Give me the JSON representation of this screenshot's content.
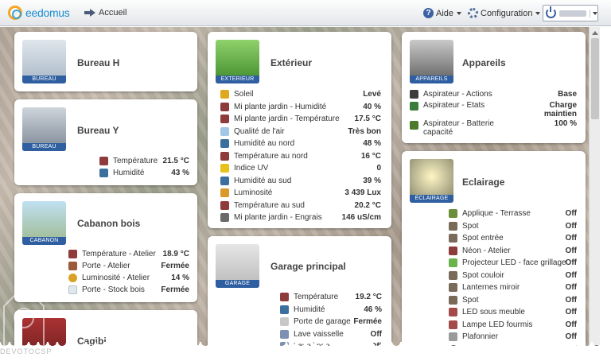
{
  "app": {
    "brand": "eedomus",
    "home_label": "Accueil"
  },
  "menu": {
    "help_label": "Aide",
    "config_label": "Configuration"
  },
  "watermark": {
    "text": "DEVOTOCSP"
  },
  "cards": {
    "bureau_h": {
      "title": "Bureau H",
      "thumb_label": "BUREAU"
    },
    "bureau_y": {
      "title": "Bureau Y",
      "thumb_label": "BUREAU",
      "rows": [
        {
          "label": "Température",
          "value": "21.5 °C"
        },
        {
          "label": "Humidité",
          "value": "43 %"
        }
      ]
    },
    "cabanon": {
      "title": "Cabanon bois",
      "thumb_label": "CABANON",
      "rows": [
        {
          "label": "Température - Atelier",
          "value": "18.9 °C"
        },
        {
          "label": "Porte - Atelier",
          "value": "Fermée"
        },
        {
          "label": "Luminosité - Atelier",
          "value": "14 %"
        },
        {
          "label": "Porte - Stock bois",
          "value": "Fermée"
        }
      ]
    },
    "cagibi": {
      "title": "Cagibi"
    },
    "exterieur": {
      "title": "Extérieur",
      "thumb_label": "EXTERIEUR",
      "rows": [
        {
          "label": "Soleil",
          "value": "Levé"
        },
        {
          "label": "Mi plante jardin - Humidité",
          "value": "40 %"
        },
        {
          "label": "Mi plante jardin - Température",
          "value": "17.5 °C"
        },
        {
          "label": "Qualité de l'air",
          "value": "Très bon"
        },
        {
          "label": "Humidité au nord",
          "value": "48 %"
        },
        {
          "label": "Température au nord",
          "value": "16 °C"
        },
        {
          "label": "Indice UV",
          "value": "0"
        },
        {
          "label": "Humidité au sud",
          "value": "39 %"
        },
        {
          "label": "Luminosité",
          "value": "3 439 Lux"
        },
        {
          "label": "Température au sud",
          "value": "20.2 °C"
        },
        {
          "label": "Mi plante jardin - Engrais",
          "value": "146 uS/cm"
        }
      ]
    },
    "garage": {
      "title": "Garage principal",
      "thumb_label": "GARAGE",
      "rows": [
        {
          "label": "Température",
          "value": "19.2 °C"
        },
        {
          "label": "Humidité",
          "value": "46 %"
        },
        {
          "label": "Porte de garage",
          "value": "Fermée"
        },
        {
          "label": "Lave vaisselle",
          "value": "Off"
        },
        {
          "label": "Lave linge",
          "value": "Off"
        }
      ]
    },
    "appareils": {
      "title": "Appareils",
      "thumb_label": "APPAREILS",
      "rows": [
        {
          "label": "Aspirateur - Actions",
          "value": "Base"
        },
        {
          "label": "Aspirateur - Etats",
          "value_line1": "Charge",
          "value_line2": "maintien"
        },
        {
          "label_line1": "Aspirateur - Batterie",
          "label_line2": "capacité",
          "value": "100 %"
        }
      ]
    },
    "eclairage": {
      "title": "Eclairage",
      "thumb_label": "ÉCLAIRAGE",
      "rows": [
        {
          "label": "Applique - Terrasse",
          "value": "Off"
        },
        {
          "label": "Spot",
          "value": "Off"
        },
        {
          "label": "Spot entrée",
          "value": "Off"
        },
        {
          "label": "Néon - Atelier",
          "value": "Off"
        },
        {
          "label": "Projecteur LED - face grillage",
          "value": "Off"
        },
        {
          "label": "Spot couloir",
          "value": "Off"
        },
        {
          "label": "Lanternes miroir",
          "value": "Off"
        },
        {
          "label": "Spot",
          "value": "Off"
        },
        {
          "label": "LED sous meuble",
          "value": "Off"
        },
        {
          "label": "Lampe LED fourmis",
          "value": "Off"
        },
        {
          "label": "Plafonnier",
          "value": "Off"
        },
        {
          "label": "Spot",
          "value": "Off"
        }
      ]
    }
  }
}
